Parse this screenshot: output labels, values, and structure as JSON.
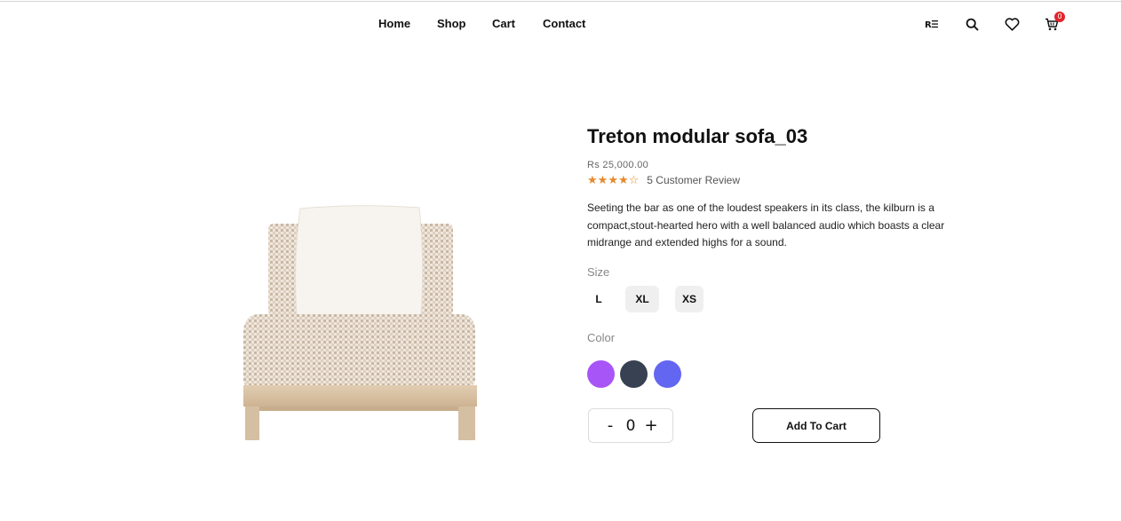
{
  "nav": {
    "links": [
      "Home",
      "Shop",
      "Cart",
      "Contact"
    ]
  },
  "header_icons": [
    "account-list-icon",
    "search-icon",
    "heart-icon",
    "cart-icon"
  ],
  "cart_badge": "0",
  "product": {
    "title": "Treton modular sofa_03",
    "price": "Rs 25,000.00",
    "rating": 4,
    "rating_max": 5,
    "review_text": "5 Customer Review",
    "description": "Seeting the bar as one of the loudest speakers in its class, the kilburn is a compact,stout-hearted hero with a well balanced audio which boasts a clear midrange and extended highs for a sound.",
    "size_label": "Size",
    "sizes": [
      "L",
      "XL",
      "XS"
    ],
    "selected_size": "L",
    "color_label": "Color",
    "colors": [
      "#a855f7",
      "#374151",
      "#6366f1"
    ],
    "quantity": "0",
    "qty_minus": "-",
    "qty_plus": "+",
    "add_to_cart": "Add To Cart"
  },
  "colors": {
    "star": "#e58a2c",
    "badge": "#e0262c"
  }
}
